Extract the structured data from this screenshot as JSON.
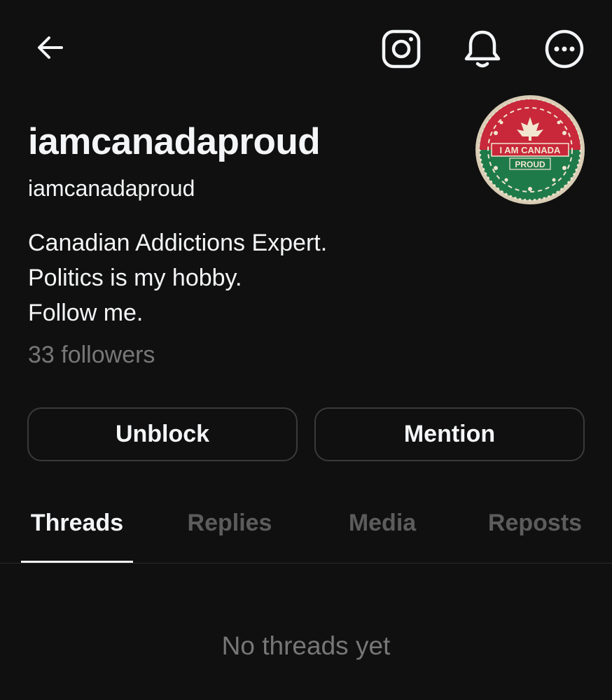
{
  "header": {
    "back_icon": "arrow-left-icon",
    "instagram_icon": "instagram-icon",
    "notifications_icon": "bell-icon",
    "more_icon": "more-options-icon"
  },
  "profile": {
    "display_name": "iamcanadaproud",
    "username": "iamcanadaproud",
    "bio": [
      "Canadian Addictions Expert.",
      "Politics is my hobby.",
      "Follow me."
    ],
    "followers": "33 followers",
    "avatar": {
      "text_top": "I AM CANADA",
      "text_bottom": "PROUD",
      "colors": {
        "red": "#c8283a",
        "green": "#1f7a4a",
        "cream": "#f2e6d0",
        "ring": "#d9cdb6"
      }
    }
  },
  "actions": {
    "unblock_label": "Unblock",
    "mention_label": "Mention"
  },
  "tabs": [
    {
      "label": "Threads",
      "active": true
    },
    {
      "label": "Replies",
      "active": false
    },
    {
      "label": "Media",
      "active": false
    },
    {
      "label": "Reposts",
      "active": false
    }
  ],
  "empty_state": "No threads yet",
  "colors": {
    "background": "#101010",
    "text_primary": "#f3f5f7",
    "text_secondary": "#777777",
    "tab_inactive": "#5c5c5c",
    "button_border": "#3a3a3a"
  }
}
